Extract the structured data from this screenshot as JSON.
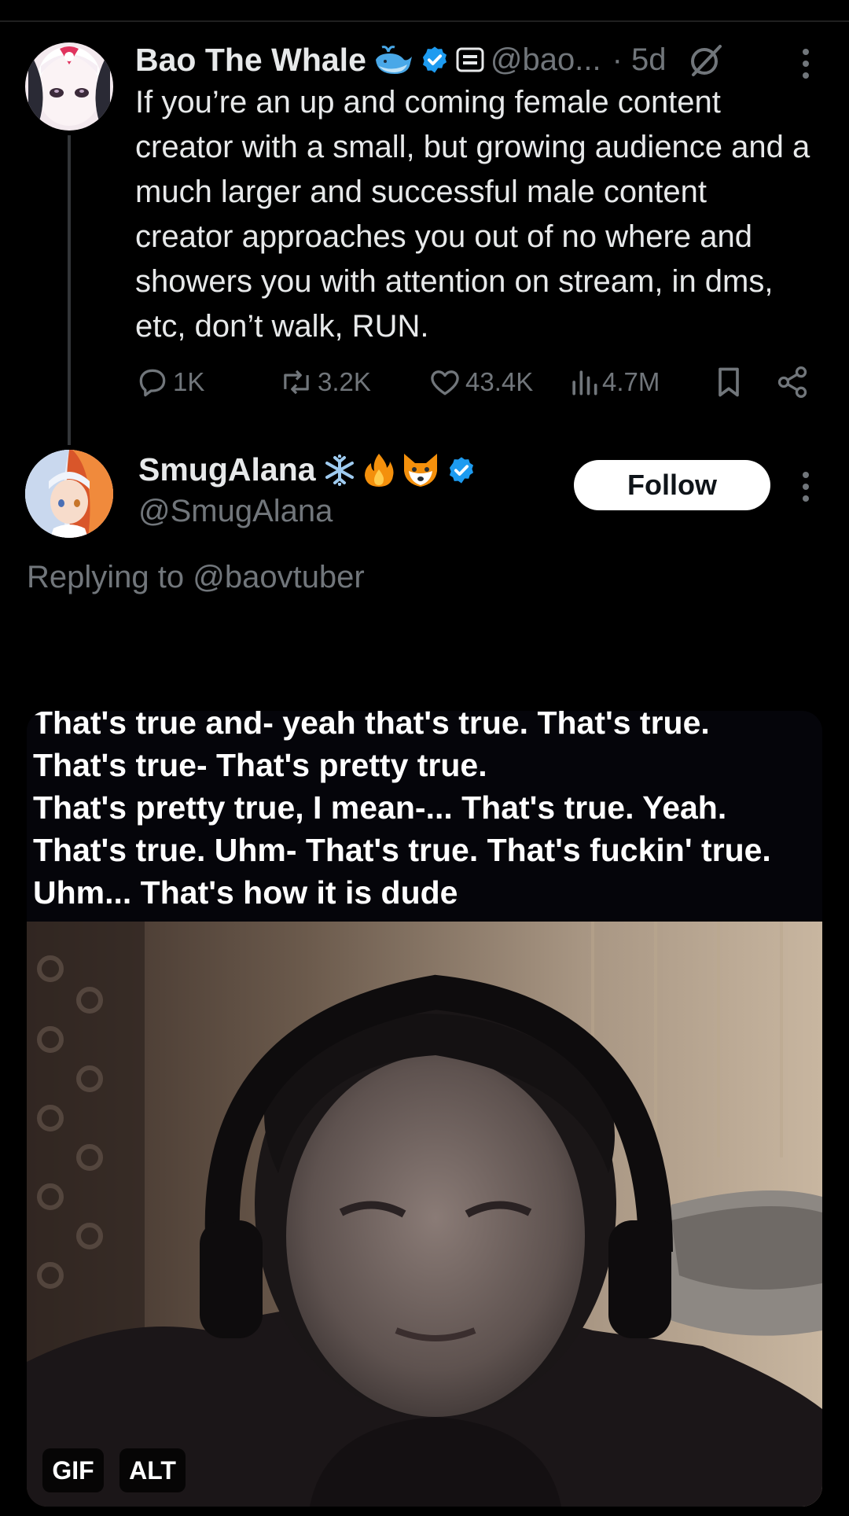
{
  "tweet": {
    "author": {
      "name": "Bao The Whale",
      "handle": "@bao...",
      "time": "· 5d"
    },
    "text": "If you’re an up and coming female content creator with a small, but growing audience and a much larger and successful male content creator approaches you out of no where and showers you with attention on stream, in dms, etc, don’t walk, RUN.",
    "stats": {
      "replies": "1K",
      "reposts": "3.2K",
      "likes": "43.4K",
      "views": "4.7M"
    }
  },
  "reply": {
    "author": {
      "name": "SmugAlana",
      "handle": "@SmugAlana"
    },
    "follow_label": "Follow",
    "replying_to": "Replying to @baovtuber",
    "media": {
      "caption_lines": [
        "That's true and- yeah that's true. That's true.",
        "That's true- That's pretty true.",
        "That's pretty true, I mean-... That's true. Yeah.",
        "That's true. Uhm- That's true. That's fuckin' true.",
        "Uhm... That's how it is dude"
      ],
      "gif_label": "GIF",
      "alt_label": "ALT"
    }
  },
  "colors": {
    "background": "#000000",
    "primary_text": "#e7e9ea",
    "secondary_text": "#71767b",
    "verified": "#1d9bf0"
  }
}
